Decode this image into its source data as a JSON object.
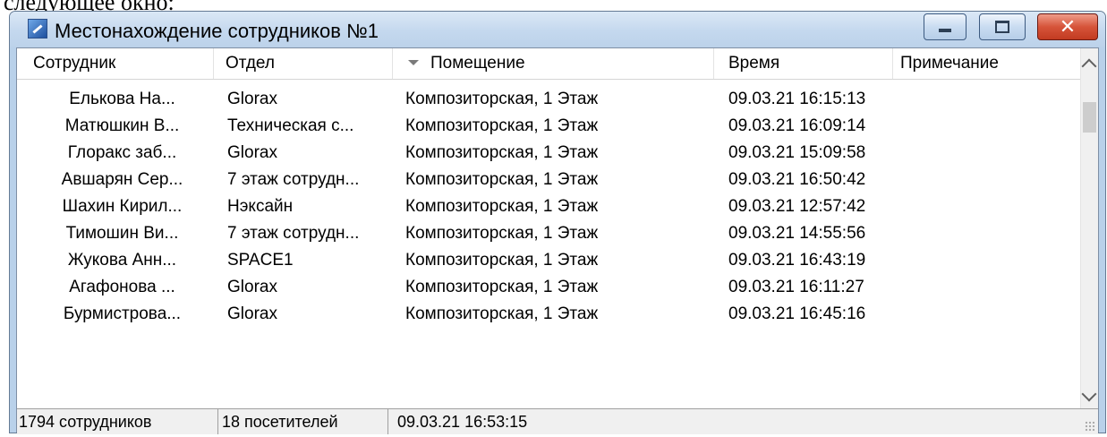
{
  "document": {
    "text": "следующее окно:"
  },
  "window": {
    "title": "Местонахождение сотрудников №1",
    "close_glyph": "✕"
  },
  "columns": [
    "Сотрудник",
    "Отдел",
    "Помещение",
    "Время",
    "Примечание"
  ],
  "rows": [
    [
      "Елькова На...",
      "Glorax",
      "Композиторская, 1 Этаж",
      "09.03.21 16:15:13",
      ""
    ],
    [
      "Матюшкин В...",
      "Техническая с...",
      "Композиторская, 1 Этаж",
      "09.03.21 16:09:14",
      ""
    ],
    [
      "Глоракс заб...",
      "Glorax",
      "Композиторская, 1 Этаж",
      "09.03.21 15:09:58",
      ""
    ],
    [
      "Авшарян Сер...",
      "7 этаж сотрудн...",
      "Композиторская, 1 Этаж",
      "09.03.21 16:50:42",
      ""
    ],
    [
      "Шахин Кирил...",
      "Нэксайн",
      "Композиторская, 1 Этаж",
      "09.03.21 12:57:42",
      ""
    ],
    [
      "Тимошин Ви...",
      "7 этаж сотрудн...",
      "Композиторская, 1 Этаж",
      "09.03.21 14:55:56",
      ""
    ],
    [
      "Жукова Анн...",
      "SPACE1",
      "Композиторская, 1 Этаж",
      "09.03.21 16:43:19",
      ""
    ],
    [
      "Агафонова ...",
      "Glorax",
      "Композиторская, 1 Этаж",
      "09.03.21 16:11:27",
      ""
    ],
    [
      "Бурмистрова...",
      "Glorax",
      "Композиторская, 1 Этаж",
      "09.03.21 16:45:16",
      ""
    ]
  ],
  "status": {
    "employees": "1794 сотрудников",
    "visitors": "18 посетителей",
    "datetime": "09.03.21 16:53:15"
  },
  "colors": {
    "titlebar": "#c4d8ee",
    "close_button": "#d6543a",
    "statusbar": "#f0f0f0"
  }
}
